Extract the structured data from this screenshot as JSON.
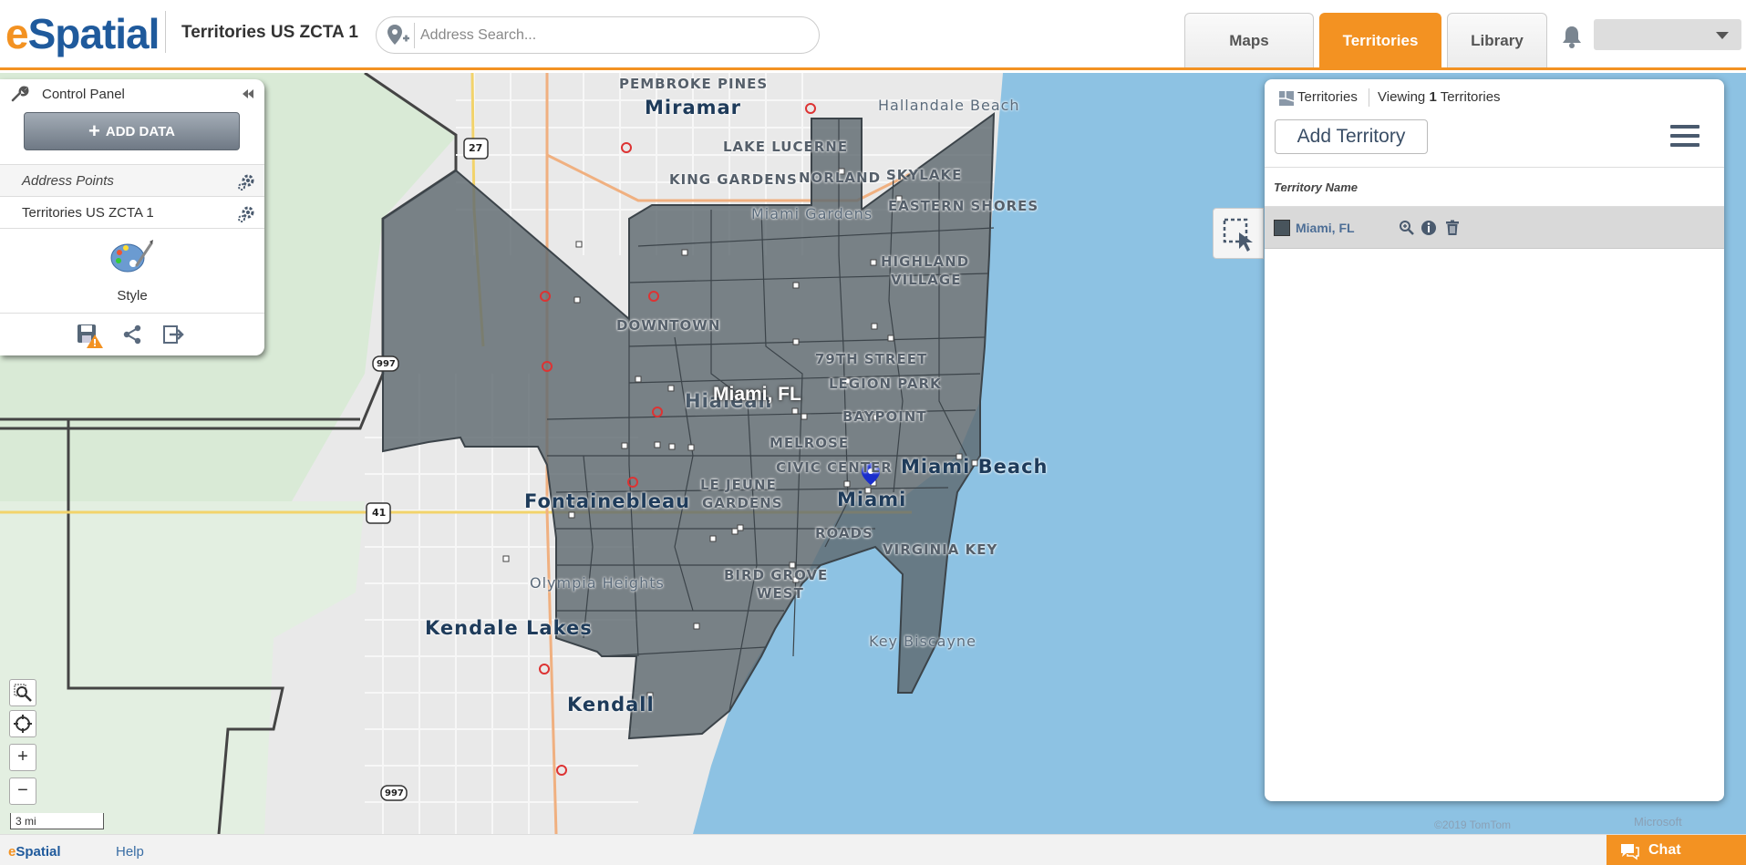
{
  "header": {
    "logo_e": "e",
    "logo_rest": "Spatial",
    "map_title": "Territories US ZCTA 1",
    "search": {
      "placeholder": "Address Search...",
      "value": ""
    },
    "tabs": [
      {
        "label": "Maps",
        "active": false
      },
      {
        "label": "Territories",
        "active": true
      },
      {
        "label": "Library",
        "active": false
      }
    ],
    "accent_color": "#f39222",
    "brand_color": "#1f5a9c"
  },
  "control_panel": {
    "title": "Control Panel",
    "add_data_label": "ADD DATA",
    "layers": [
      {
        "label": "Address Points"
      },
      {
        "label": "Territories US ZCTA 1"
      }
    ],
    "style_label": "Style"
  },
  "map": {
    "territory_label": "Miami, FL",
    "labels": {
      "pembroke_pines": "PEMBROKE PINES",
      "miramar": "Miramar",
      "hallandale": "Hallandale Beach",
      "lake_lucerne": "LAKE LUCERNE",
      "king_gardens": "KING GARDENS",
      "norland": "NORLAND",
      "skylake": "SKYLAKE",
      "miami_gardens": "Miami Gardens",
      "eastern_shores": "EASTERN SHORES",
      "highland_village_1": "HIGHLAND",
      "highland_village_2": "VILLAGE",
      "downtown": "DOWNTOWN",
      "seventy_ninth": "79TH STREET",
      "legion_park": "LEGION PARK",
      "hialeah": "Hialeah",
      "baypoint": "BAYPOINT",
      "melrose": "MELROSE",
      "civic_center": "CIVIC CENTER",
      "miami_beach": "Miami Beach",
      "le_jeune_1": "LE JEUNE",
      "le_jeune_2": "GARDENS",
      "fontainebleau": "Fontainebleau",
      "miami": "Miami",
      "roads": "ROADS",
      "virginia_key": "VIRGINIA KEY",
      "olympia_heights": "Olympia Heights",
      "bird_grove_1": "BIRD GROVE",
      "bird_grove_2": "WEST",
      "kendale_lakes": "Kendale Lakes",
      "key_biscayne": "Key Biscayne",
      "kendall": "Kendall"
    },
    "shields": {
      "us27": "27",
      "fl997a": "997",
      "us41": "41",
      "fl997b": "997"
    },
    "tomtom_credit": "©2019 TomTom",
    "ms_credit": "Microsoft",
    "scale_label": "3 mi",
    "territory_color": "#5f6a70"
  },
  "territories_panel": {
    "title": "Territories",
    "viewing_prefix": "Viewing",
    "viewing_count": "1",
    "viewing_suffix": "Territories",
    "add_button": "Add Territory",
    "column_header": "Territory Name",
    "rows": [
      {
        "name": "Miami, FL",
        "color": "#48545c"
      }
    ]
  },
  "footer": {
    "logo_e": "e",
    "logo_rest": "Spatial",
    "help": "Help",
    "chat": "Chat"
  }
}
